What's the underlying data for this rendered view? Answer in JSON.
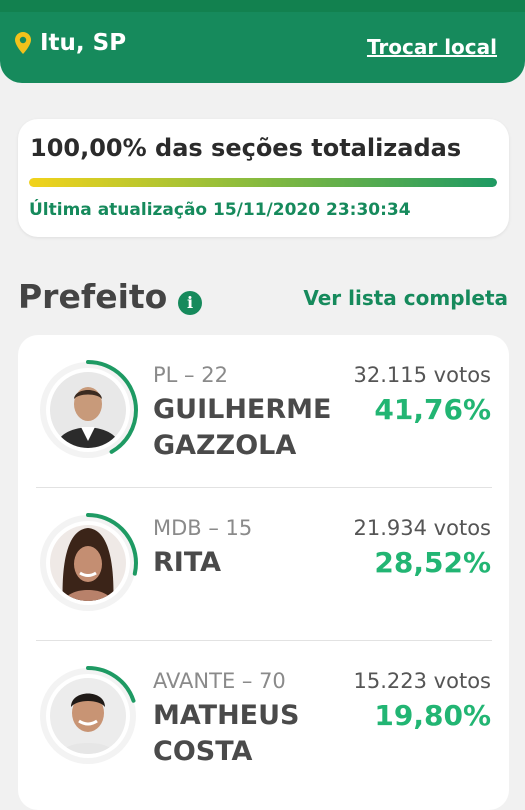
{
  "location": {
    "city": "Itu, SP",
    "change_label": "Trocar local"
  },
  "status": {
    "sections_text": "100,00% das seções totalizadas",
    "progress_fraction": 1.0,
    "update_text": "Última atualização 15/11/2020 23:30:34"
  },
  "office": {
    "title": "Prefeito",
    "info_icon": "info-icon",
    "full_list_label": "Ver lista completa"
  },
  "colors": {
    "brand": "#168a5c",
    "percent": "#22b573"
  },
  "candidates": [
    {
      "party": "PL – 22",
      "name": "GUILHERME GAZZOLA",
      "votes": "32.115 votos",
      "percent": "41,76%",
      "percent_value": 41.76
    },
    {
      "party": "MDB – 15",
      "name": "RITA",
      "votes": "21.934 votos",
      "percent": "28,52%",
      "percent_value": 28.52
    },
    {
      "party": "AVANTE – 70",
      "name": "MATHEUS COSTA",
      "votes": "15.223 votos",
      "percent": "19,80%",
      "percent_value": 19.8
    }
  ]
}
